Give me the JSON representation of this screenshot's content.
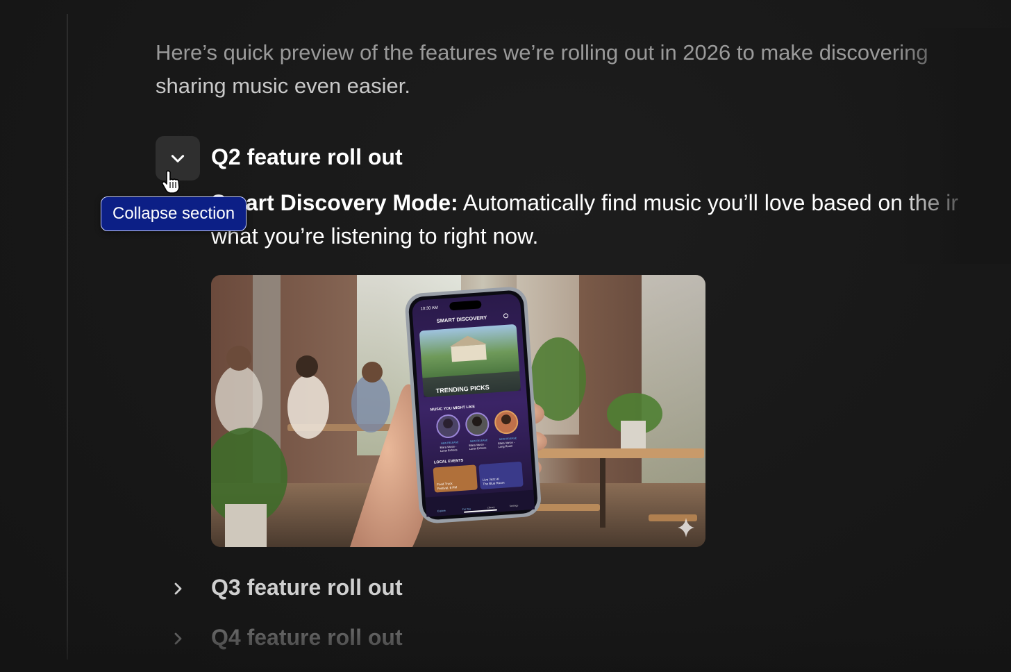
{
  "intro": {
    "line1": "Here’s quick preview of the features we’re rolling out in 2026 to make discovering",
    "line2": "sharing music even easier."
  },
  "sections": {
    "q2": {
      "title": "Q2 feature roll out",
      "feature_name": "Smart Discovery Mode:",
      "feature_desc_line1": " Automatically find music you’ll love based on the ir",
      "feature_desc_line2": "what you’re listening to right now."
    },
    "q3": {
      "title": "Q3 feature roll out"
    },
    "q4": {
      "title": "Q4 feature roll out"
    }
  },
  "tooltip": {
    "text": "Collapse section"
  },
  "phone": {
    "time": "10:30 AM",
    "header": "SMART DISCOVERY",
    "hero_label": "TRENDING PICKS",
    "music_heading": "MUSIC YOU MIGHT LIKE",
    "artists": [
      {
        "tag": "NEW RELEASE",
        "name": "Elara Vance -",
        "album": "Lunar Echoes"
      },
      {
        "tag": "NEW RELEASE",
        "name": "Elara Vance -",
        "album": "Lunar Echoes"
      },
      {
        "tag": "NEW RELEASE",
        "name": "Elara Vance -",
        "album": "Long Room"
      }
    ],
    "events_heading": "LOCAL EVENTS",
    "events": [
      {
        "line1": "Food Truck",
        "line2": "Festival, 6 PM"
      },
      {
        "line1": "Live Jazz at",
        "line2": "The Blue Room"
      }
    ],
    "tabs": [
      "Explore",
      "For You",
      "Library",
      "Settings"
    ]
  },
  "colors": {
    "background": "#181818",
    "tooltip_bg": "#0c1f86",
    "toggle_bg": "#2f2f2f",
    "text_primary": "#ffffff",
    "text_muted": "#9a9a9a"
  },
  "icons": {
    "toggle": "chevron-down-icon",
    "collapsed": "chevron-right-icon",
    "cursor": "hand-pointer-icon",
    "image_badge": "sparkle-icon"
  }
}
